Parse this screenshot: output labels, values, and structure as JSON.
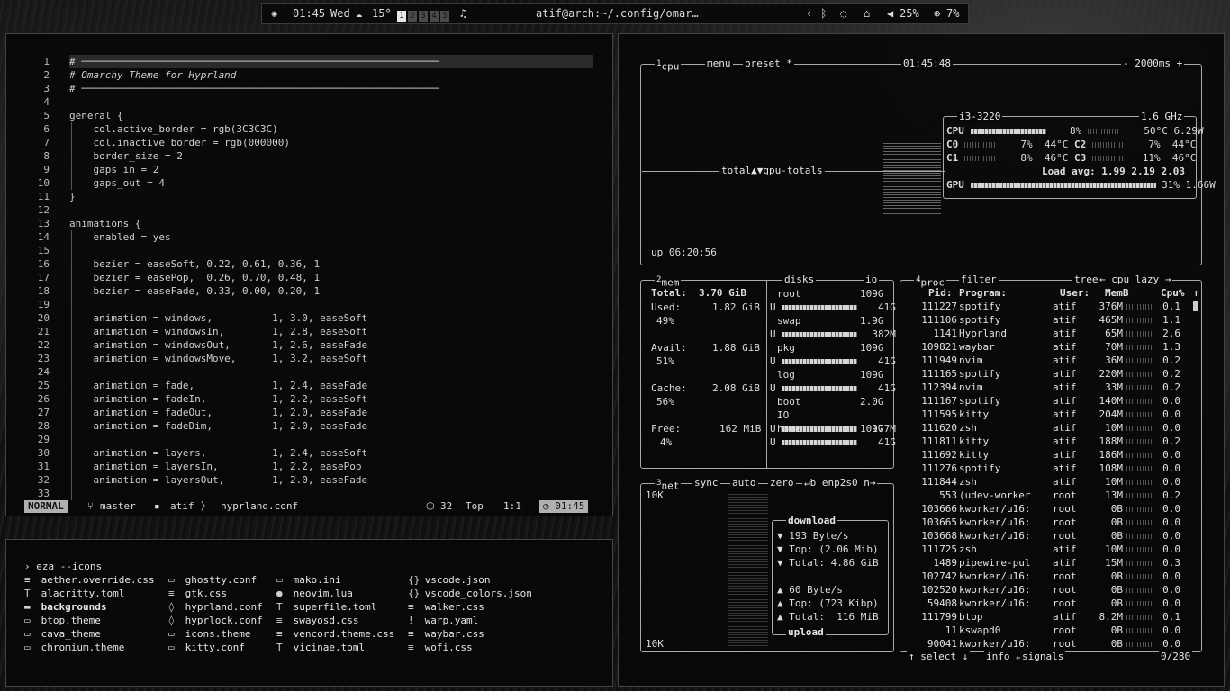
{
  "topbar": {
    "time": "01:45",
    "day": "Wed",
    "weather": "15°",
    "workspaces": [
      "1",
      "2",
      "3",
      "4",
      "5"
    ],
    "active_workspace": "1",
    "window_title": "atif@arch:~/.config/omar…",
    "volume": "25%",
    "cpu": "7%"
  },
  "editor": {
    "lines": [
      {
        "n": "1",
        "t": "# ────────────────────────────────────────────────────────────"
      },
      {
        "n": "2",
        "t": "# Omarchy Theme for Hyprland"
      },
      {
        "n": "3",
        "t": "# ────────────────────────────────────────────────────────────"
      },
      {
        "n": "4",
        "t": ""
      },
      {
        "n": "5",
        "t": "general {"
      },
      {
        "n": "6",
        "t": "    col.active_border = rgb(3C3C3C)"
      },
      {
        "n": "7",
        "t": "    col.inactive_border = rgb(000000)"
      },
      {
        "n": "8",
        "t": "    border_size = 2"
      },
      {
        "n": "9",
        "t": "    gaps_in = 2"
      },
      {
        "n": "10",
        "t": "    gaps_out = 4"
      },
      {
        "n": "11",
        "t": "}"
      },
      {
        "n": "12",
        "t": ""
      },
      {
        "n": "13",
        "t": "animations {"
      },
      {
        "n": "14",
        "t": "    enabled = yes"
      },
      {
        "n": "15",
        "t": ""
      },
      {
        "n": "16",
        "t": "    bezier = easeSoft, 0.22, 0.61, 0.36, 1"
      },
      {
        "n": "17",
        "t": "    bezier = easePop,  0.26, 0.70, 0.48, 1"
      },
      {
        "n": "18",
        "t": "    bezier = easeFade, 0.33, 0.00, 0.20, 1"
      },
      {
        "n": "19",
        "t": ""
      },
      {
        "n": "20",
        "t": "    animation = windows,          1, 3.0, easeSoft"
      },
      {
        "n": "21",
        "t": "    animation = windowsIn,        1, 2.8, easeSoft"
      },
      {
        "n": "22",
        "t": "    animation = windowsOut,       1, 2.6, easeFade"
      },
      {
        "n": "23",
        "t": "    animation = windowsMove,      1, 3.2, easeSoft"
      },
      {
        "n": "24",
        "t": ""
      },
      {
        "n": "25",
        "t": "    animation = fade,             1, 2.4, easeFade"
      },
      {
        "n": "26",
        "t": "    animation = fadeIn,           1, 2.2, easeSoft"
      },
      {
        "n": "27",
        "t": "    animation = fadeOut,          1, 2.0, easeFade"
      },
      {
        "n": "28",
        "t": "    animation = fadeDim,          1, 2.0, easeFade"
      },
      {
        "n": "29",
        "t": ""
      },
      {
        "n": "30",
        "t": "    animation = layers,           1, 2.4, easeSoft"
      },
      {
        "n": "31",
        "t": "    animation = layersIn,         1, 2.2, easePop"
      },
      {
        "n": "32",
        "t": "    animation = layersOut,        1, 2.0, easeFade"
      },
      {
        "n": "33",
        "t": ""
      }
    ],
    "status": {
      "mode": "NORMAL",
      "branch": "master",
      "user": "atif",
      "file": "hyprland.conf",
      "count": "32",
      "position": "Top",
      "cursor": "1:1",
      "clock": "01:45"
    }
  },
  "terminal": {
    "prompt": "›",
    "command": "eza --icons",
    "columns": [
      [
        {
          "icon": "≡",
          "name": "aether.override.css",
          "dir": false
        },
        {
          "icon": "T",
          "name": "alacritty.toml",
          "dir": false
        },
        {
          "icon": "▬",
          "name": "backgrounds",
          "dir": true
        },
        {
          "icon": "▭",
          "name": "btop.theme",
          "dir": false
        },
        {
          "icon": "▭",
          "name": "cava_theme",
          "dir": false
        },
        {
          "icon": "▭",
          "name": "chromium.theme",
          "dir": false
        }
      ],
      [
        {
          "icon": "▭",
          "name": "ghostty.conf",
          "dir": false
        },
        {
          "icon": "≡",
          "name": "gtk.css",
          "dir": false
        },
        {
          "icon": "◊",
          "name": "hyprland.conf",
          "dir": false
        },
        {
          "icon": "◊",
          "name": "hyprlock.conf",
          "dir": false
        },
        {
          "icon": "▭",
          "name": "icons.theme",
          "dir": false
        },
        {
          "icon": "▭",
          "name": "kitty.conf",
          "dir": false
        }
      ],
      [
        {
          "icon": "▭",
          "name": "mako.ini",
          "dir": false
        },
        {
          "icon": "●",
          "name": "neovim.lua",
          "dir": false
        },
        {
          "icon": "T",
          "name": "superfile.toml",
          "dir": false
        },
        {
          "icon": "≡",
          "name": "swayosd.css",
          "dir": false
        },
        {
          "icon": "≡",
          "name": "vencord.theme.css",
          "dir": false
        },
        {
          "icon": "T",
          "name": "vicinae.toml",
          "dir": false
        }
      ],
      [
        {
          "icon": "{}",
          "name": "vscode.json",
          "dir": false
        },
        {
          "icon": "{}",
          "name": "vscode_colors.json",
          "dir": false
        },
        {
          "icon": "≡",
          "name": "walker.css",
          "dir": false
        },
        {
          "icon": "!",
          "name": "warp.yaml",
          "dir": false
        },
        {
          "icon": "≡",
          "name": "waybar.css",
          "dir": false
        },
        {
          "icon": "≡",
          "name": "wofi.css",
          "dir": false
        }
      ]
    ]
  },
  "btop": {
    "cpu_box": {
      "num": "1",
      "title": "cpu",
      "menu": "menu",
      "preset": "preset *",
      "clock": "01:45:48",
      "interval": "- 2000ms +",
      "graph_label": "total▲▼gpu-totals",
      "uptime": "up 06:20:56",
      "model": "i3-3220",
      "freq": "1.6 GHz",
      "cpu_total": {
        "label": "CPU",
        "pct": "8%",
        "temp": "50°C",
        "power": "6.29W"
      },
      "cores": [
        {
          "label": "C0",
          "pct": "7%",
          "temp": "44°C"
        },
        {
          "label": "C2",
          "pct": "7%",
          "temp": "44°C"
        },
        {
          "label": "C1",
          "pct": "8%",
          "temp": "46°C"
        },
        {
          "label": "C3",
          "pct": "11%",
          "temp": "46°C"
        }
      ],
      "load": "Load avg: 1.99 2.19 2.03",
      "gpu": {
        "label": "GPU",
        "pct": "31%",
        "power": "1.66W"
      }
    },
    "mem_box": {
      "num": "2",
      "title": "mem",
      "disks_title": "disks",
      "io_title": "io",
      "total": "Total:  3.70 GiB",
      "used_label": "Used:",
      "used_val": "1.82 GiB",
      "used_pct": "49%",
      "avail_label": "Avail:",
      "avail_val": "1.88 GiB",
      "avail_pct": "51%",
      "cache_label": "Cache:",
      "cache_val": "2.08 GiB",
      "cache_pct": "56%",
      "free_label": "Free:",
      "free_val": "162 MiB",
      "free_pct": "4%",
      "disks": [
        {
          "name": "root",
          "size": "109G",
          "used": "41G"
        },
        {
          "name": "swap",
          "size": "1.9G",
          "used": "382M"
        },
        {
          "name": "pkg",
          "size": "109G",
          "used": "41G"
        },
        {
          "name": "log",
          "size": "109G",
          "used": "41G"
        },
        {
          "name": "boot",
          "size": "2.0G",
          "used": "177M",
          "io": "IO"
        },
        {
          "name": "home",
          "size": "109G",
          "used": "41G"
        }
      ]
    },
    "net_box": {
      "num": "3",
      "title": "net",
      "sync": "sync",
      "auto": "auto",
      "zero": "zero",
      "iface": "↵b enp2s0 n→",
      "scale_top": "10K",
      "scale_bottom": "10K",
      "download_title": "download",
      "dl_rate": "193 Byte/s",
      "dl_top": "Top: (2.06 Mib)",
      "dl_total": "Total: 4.86 GiB",
      "ul_rate": "60 Byte/s",
      "ul_top": "Top: (723 Kibp)",
      "ul_total": "Total:  116 MiB",
      "upload_title": "upload"
    },
    "proc_box": {
      "num": "4",
      "title": "proc",
      "filter": "filter",
      "tree": "tree",
      "sort": "← cpu lazy →",
      "headers": {
        "pid": "Pid:",
        "program": "Program:",
        "user": "User:",
        "mem": "MemB",
        "cpu": "Cpu%"
      },
      "rows": [
        {
          "pid": "111227",
          "program": "spotify",
          "user": "atif",
          "mem": "376M",
          "cpu": "0.1"
        },
        {
          "pid": "111106",
          "program": "spotify",
          "user": "atif",
          "mem": "465M",
          "cpu": "1.1"
        },
        {
          "pid": "1141",
          "program": "Hyprland",
          "user": "atif",
          "mem": "65M",
          "cpu": "2.6"
        },
        {
          "pid": "109821",
          "program": "waybar",
          "user": "atif",
          "mem": "70M",
          "cpu": "1.3"
        },
        {
          "pid": "111949",
          "program": "nvim",
          "user": "atif",
          "mem": "36M",
          "cpu": "0.2"
        },
        {
          "pid": "111165",
          "program": "spotify",
          "user": "atif",
          "mem": "220M",
          "cpu": "0.2"
        },
        {
          "pid": "112394",
          "program": "nvim",
          "user": "atif",
          "mem": "33M",
          "cpu": "0.2"
        },
        {
          "pid": "111167",
          "program": "spotify",
          "user": "atif",
          "mem": "140M",
          "cpu": "0.0"
        },
        {
          "pid": "111595",
          "program": "kitty",
          "user": "atif",
          "mem": "204M",
          "cpu": "0.0"
        },
        {
          "pid": "111620",
          "program": "zsh",
          "user": "atif",
          "mem": "10M",
          "cpu": "0.0"
        },
        {
          "pid": "111811",
          "program": "kitty",
          "user": "atif",
          "mem": "188M",
          "cpu": "0.2"
        },
        {
          "pid": "111692",
          "program": "kitty",
          "user": "atif",
          "mem": "186M",
          "cpu": "0.0"
        },
        {
          "pid": "111276",
          "program": "spotify",
          "user": "atif",
          "mem": "108M",
          "cpu": "0.0"
        },
        {
          "pid": "111844",
          "program": "zsh",
          "user": "atif",
          "mem": "10M",
          "cpu": "0.0"
        },
        {
          "pid": "553",
          "program": "(udev-worker",
          "user": "root",
          "mem": "13M",
          "cpu": "0.2"
        },
        {
          "pid": "103666",
          "program": "kworker/u16:",
          "user": "root",
          "mem": "0B",
          "cpu": "0.0"
        },
        {
          "pid": "103665",
          "program": "kworker/u16:",
          "user": "root",
          "mem": "0B",
          "cpu": "0.0"
        },
        {
          "pid": "103668",
          "program": "kworker/u16:",
          "user": "root",
          "mem": "0B",
          "cpu": "0.0"
        },
        {
          "pid": "111725",
          "program": "zsh",
          "user": "atif",
          "mem": "10M",
          "cpu": "0.0"
        },
        {
          "pid": "1489",
          "program": "pipewire-pul",
          "user": "atif",
          "mem": "15M",
          "cpu": "0.3"
        },
        {
          "pid": "102742",
          "program": "kworker/u16:",
          "user": "root",
          "mem": "0B",
          "cpu": "0.0"
        },
        {
          "pid": "102520",
          "program": "kworker/u16:",
          "user": "root",
          "mem": "0B",
          "cpu": "0.0"
        },
        {
          "pid": "59408",
          "program": "kworker/u16:",
          "user": "root",
          "mem": "0B",
          "cpu": "0.0"
        },
        {
          "pid": "111799",
          "program": "btop",
          "user": "atif",
          "mem": "8.2M",
          "cpu": "0.1"
        },
        {
          "pid": "11",
          "program": "kswapd0",
          "user": "root",
          "mem": "0B",
          "cpu": "0.0"
        },
        {
          "pid": "90041",
          "program": "kworker/u16:",
          "user": "root",
          "mem": "0B",
          "cpu": "0.0"
        }
      ],
      "footer_select": "↑ select ↓",
      "footer_info": "info ↵",
      "footer_signals": "signals",
      "footer_count": "0/280"
    }
  }
}
